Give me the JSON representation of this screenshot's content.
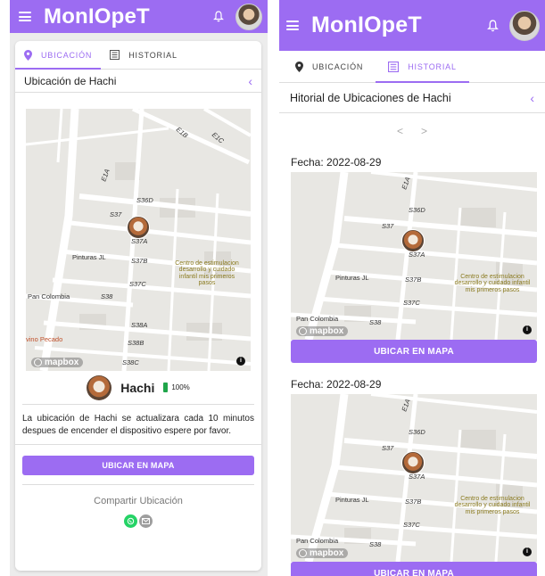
{
  "app": {
    "title": "MonIOpeT"
  },
  "left": {
    "tabs": [
      {
        "label": "UBICACIÓN",
        "active": true
      },
      {
        "label": "HISTORIAL",
        "active": false
      }
    ],
    "section_title": "Ubicación de Hachi",
    "back_icon": "chevron-left-icon",
    "map": {
      "streets": [
        "E1B",
        "E1C",
        "E1A",
        "S36D",
        "S37",
        "S37A",
        "S37B",
        "S37C",
        "S38",
        "S38A",
        "S38B",
        "S38C"
      ],
      "places": [
        "Pinturas JL",
        "Pan Colombia",
        "vino Pecado"
      ],
      "poi": "Centro de estimulacion desarrollo y cuidado infantil mis primeros pasos",
      "brand": "mapbox"
    },
    "pet": {
      "name": "Hachi",
      "battery": "100%"
    },
    "info": "La ubicación de Hachi se actualizara cada 10 minutos despues de encender el dispositivo espere por favor.",
    "button": "UBICAR EN MAPA",
    "share": {
      "label": "Compartir Ubicación",
      "icons": [
        "whatsapp-icon",
        "mail-icon"
      ]
    }
  },
  "right": {
    "tabs": [
      {
        "label": "UBICACIÓN",
        "active": false
      },
      {
        "label": "HISTORIAL",
        "active": true
      }
    ],
    "section_title": "Hitorial de Ubicaciones de Hachi",
    "pager": {
      "prev": "<",
      "next": ">"
    },
    "entries": [
      {
        "fecha": "Fecha: 2022-08-29",
        "button": "UBICAR EN MAPA"
      },
      {
        "fecha": "Fecha: 2022-08-29",
        "button": "UBICAR EN MAPA"
      }
    ],
    "map": {
      "streets": [
        "E1A",
        "S36D",
        "S37",
        "S37A",
        "S37B",
        "S37C",
        "S38"
      ],
      "places": [
        "Pinturas JL",
        "Pan Colombia"
      ],
      "poi": "Centro de estimulacion desarrollo y cuidado infantil mis primeros pasos",
      "brand": "mapbox"
    }
  },
  "colors": {
    "accent": "#9c6cf2",
    "battery": "#1fa54a",
    "whatsapp": "#25d366",
    "mail": "#9e9e9e"
  }
}
